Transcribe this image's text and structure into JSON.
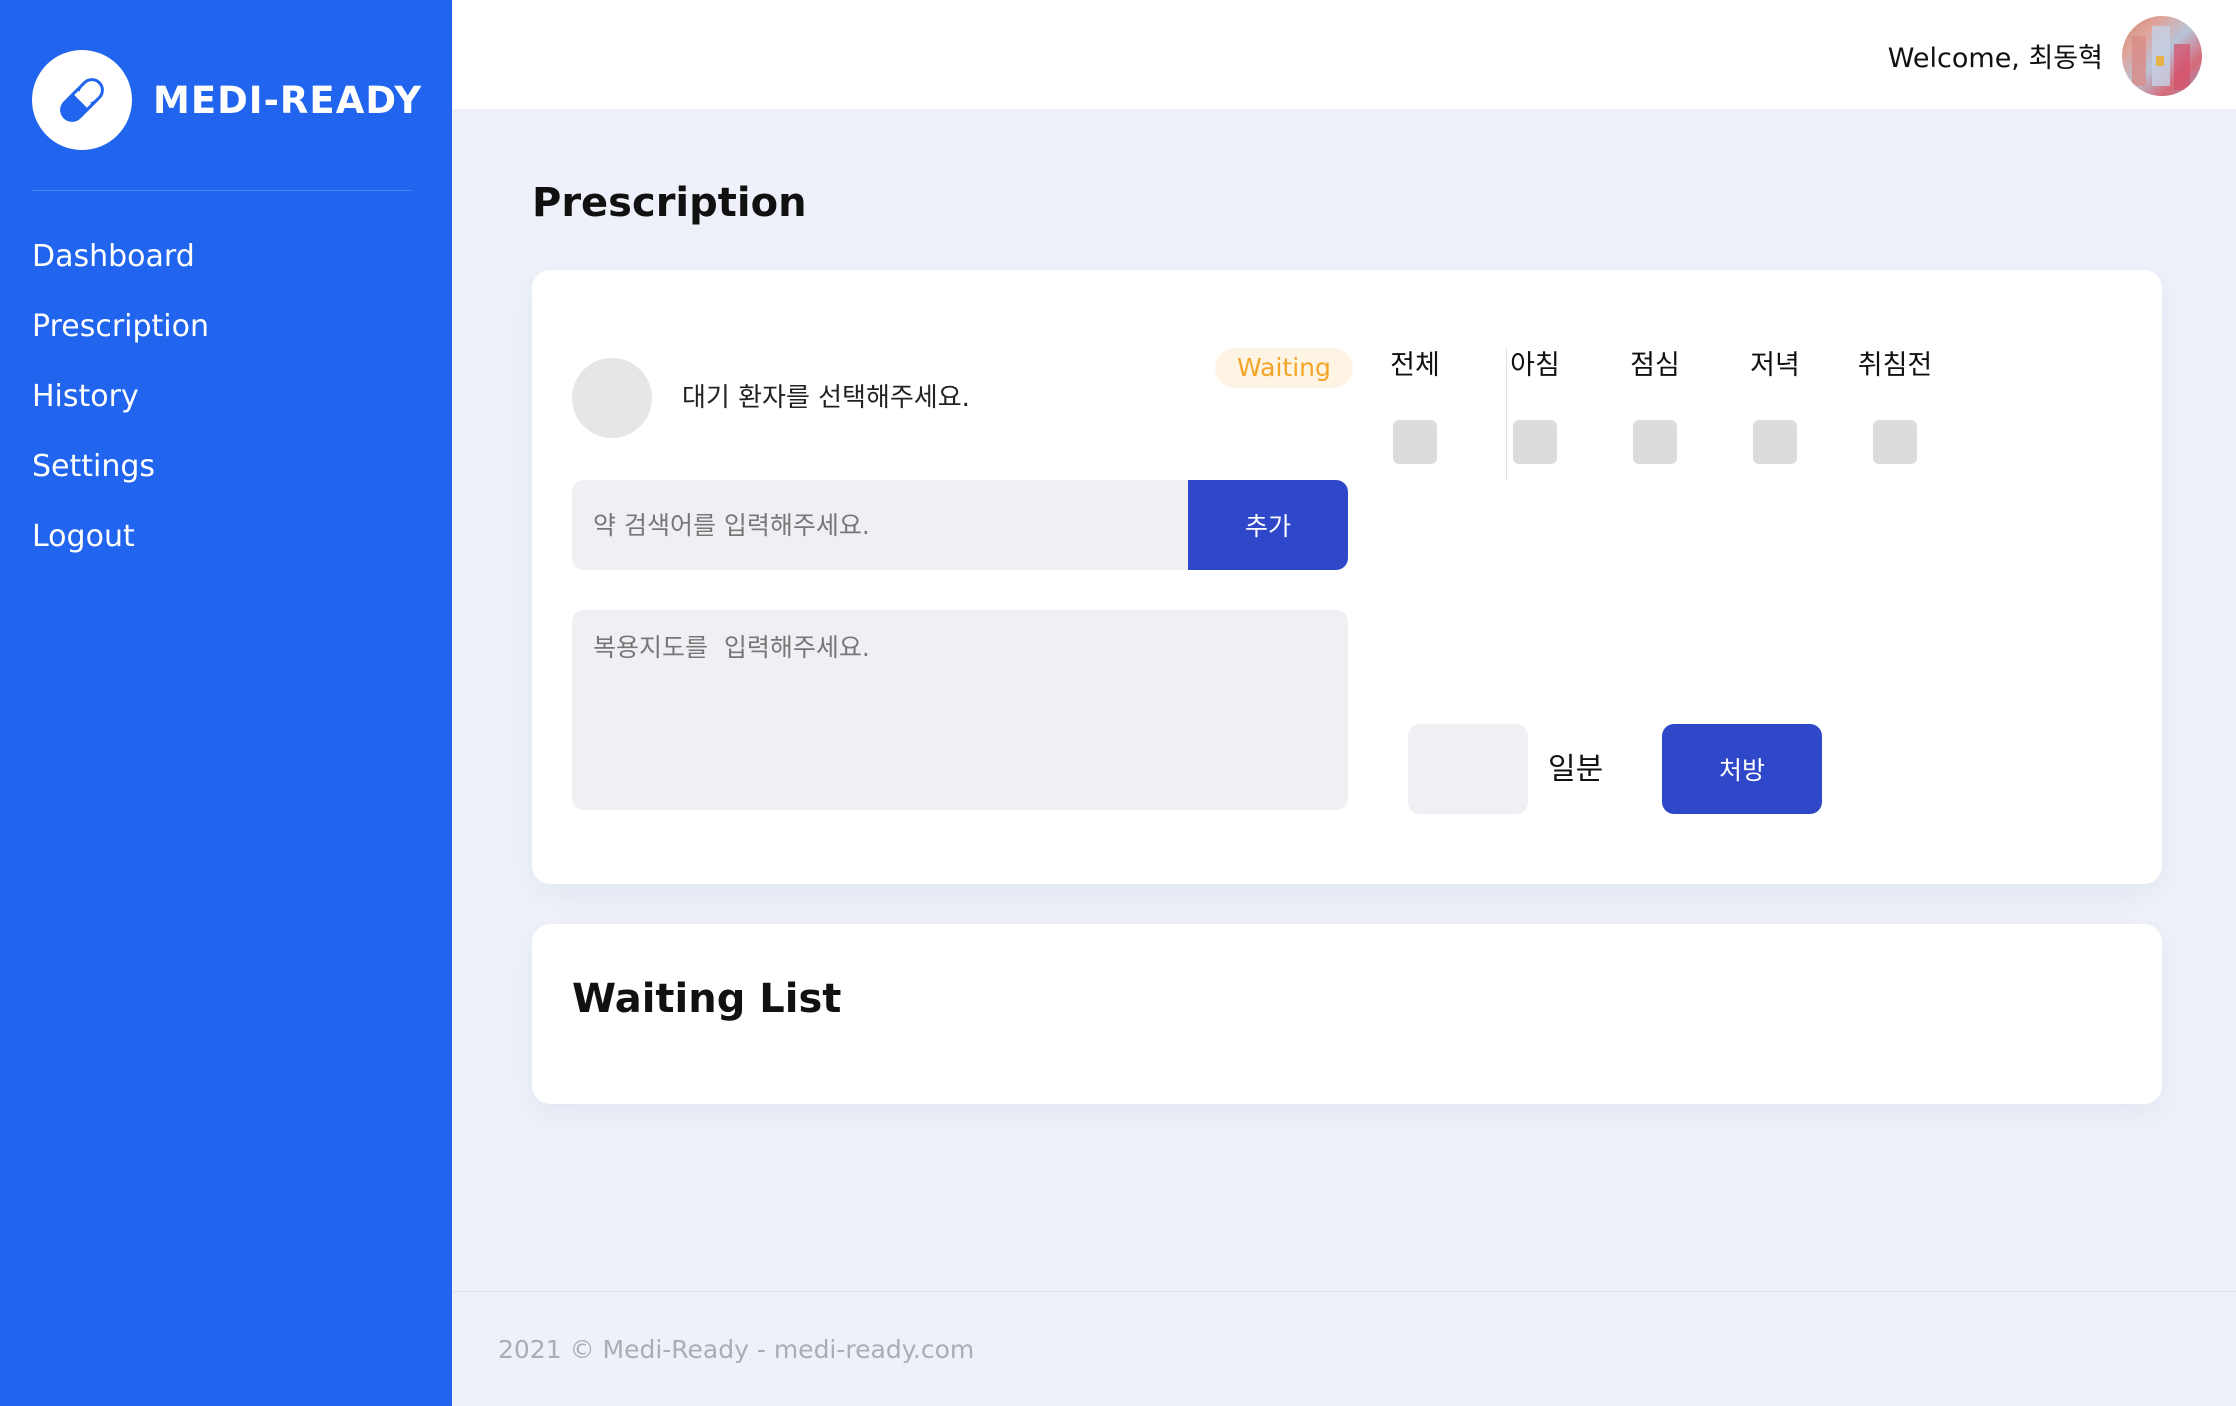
{
  "sidebar": {
    "brand": "MEDI-READY",
    "items": [
      {
        "label": "Dashboard"
      },
      {
        "label": "Prescription"
      },
      {
        "label": "History"
      },
      {
        "label": "Settings"
      },
      {
        "label": "Logout"
      }
    ]
  },
  "header": {
    "welcome": "Welcome, 최동혁"
  },
  "main": {
    "title": "Prescription",
    "patient_prompt": "대기 환자를 선택해주세요.",
    "status": "Waiting",
    "search": {
      "placeholder": "약 검색어를 입력해주세요.",
      "value": ""
    },
    "add_label": "추가",
    "instruction": {
      "placeholder": "복용지도를  입력해주세요.",
      "value": ""
    },
    "timings": [
      {
        "label": "전체",
        "checked": false
      },
      {
        "label": "아침",
        "checked": false
      },
      {
        "label": "점심",
        "checked": false
      },
      {
        "label": "저녁",
        "checked": false
      },
      {
        "label": "취침전",
        "checked": false
      }
    ],
    "days_value": "",
    "days_unit": "일분",
    "prescribe_label": "처방"
  },
  "waiting": {
    "title": "Waiting List"
  },
  "footer": {
    "text": "2021 © Medi-Ready - medi-ready.com"
  },
  "colors": {
    "sidebar": "#2164ee",
    "primary_button": "#2f48c9",
    "badge_text": "#f4a52a",
    "badge_bg": "#fef4e3",
    "background": "#eef1f9"
  },
  "icons": {
    "logo": "pill-icon"
  }
}
